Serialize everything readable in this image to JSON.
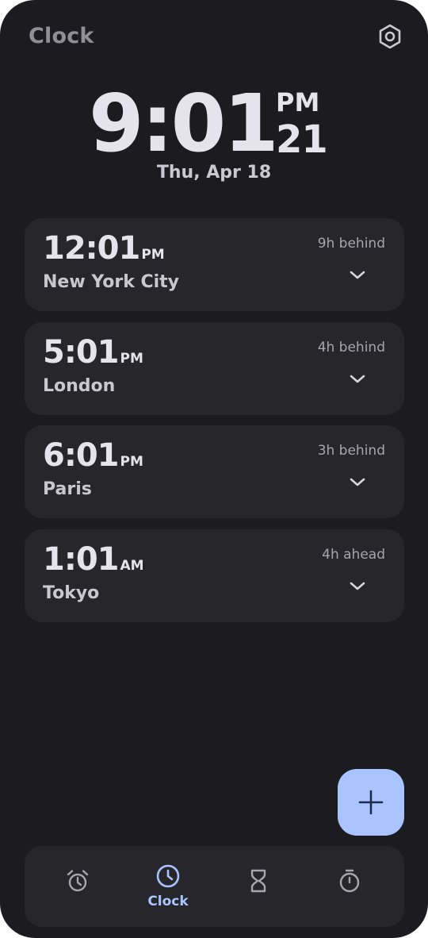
{
  "header": {
    "title": "Clock",
    "settings_icon": "settings-hexagon-icon"
  },
  "local_time": {
    "hours_minutes": "9:01",
    "ampm": "PM",
    "seconds": "21",
    "date": "Thu, Apr 18"
  },
  "cities": [
    {
      "time": "12:01",
      "suffix": "PM",
      "name": "New York City",
      "offset": "9h behind",
      "icon": "chevron-down-icon"
    },
    {
      "time": "5:01",
      "suffix": "PM",
      "name": "London",
      "offset": "4h behind",
      "icon": "chevron-down-icon"
    },
    {
      "time": "6:01",
      "suffix": "PM",
      "name": "Paris",
      "offset": "3h behind",
      "icon": "chevron-down-icon"
    },
    {
      "time": "1:01",
      "suffix": "AM",
      "name": "Tokyo",
      "offset": "4h ahead",
      "icon": "chevron-down-icon"
    }
  ],
  "fab": {
    "icon": "plus-icon"
  },
  "nav": {
    "items": [
      {
        "id": "alarm",
        "icon": "alarm-icon",
        "label": "",
        "active": false
      },
      {
        "id": "clock",
        "icon": "clock-icon",
        "label": "Clock",
        "active": true
      },
      {
        "id": "timer",
        "icon": "hourglass-icon",
        "label": "",
        "active": false
      },
      {
        "id": "stopwatch",
        "icon": "stopwatch-icon",
        "label": "",
        "active": false
      }
    ]
  },
  "colors": {
    "background": "#1c1c20",
    "card": "#26262b",
    "accent": "#aac4ff",
    "text_primary": "#e4e4ea",
    "text_secondary": "#a6a6ad"
  }
}
